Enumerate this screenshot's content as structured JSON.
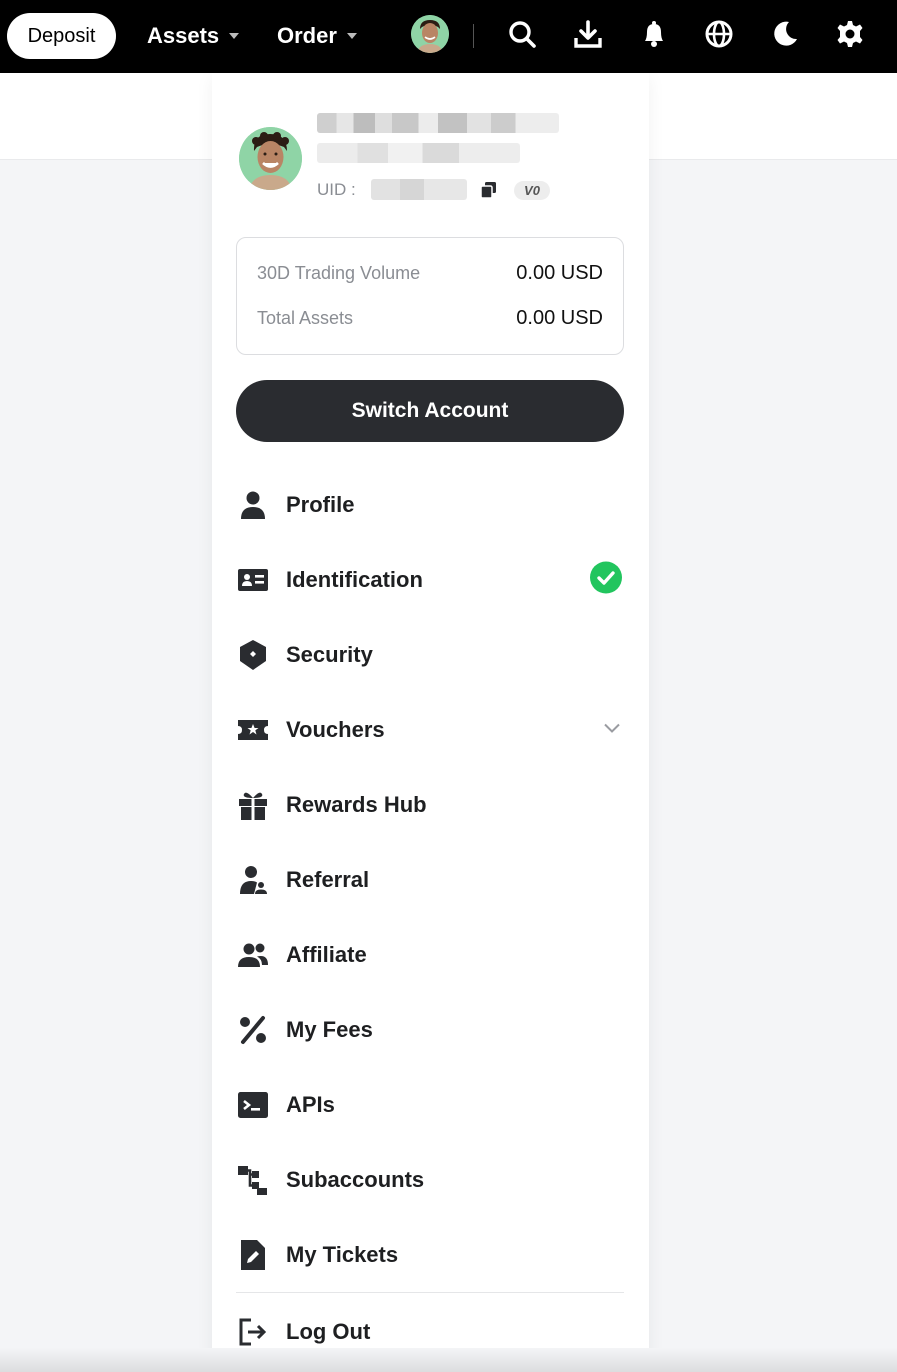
{
  "topbar": {
    "deposit_label": "Deposit",
    "assets_label": "Assets",
    "order_label": "Order",
    "icons": [
      "avatar",
      "search-icon",
      "download-icon",
      "bell-icon",
      "globe-icon",
      "moon-icon",
      "gear-icon"
    ]
  },
  "account": {
    "uid_label": "UID :",
    "vip_level": "V0"
  },
  "stats": {
    "volume_label": "30D Trading Volume",
    "volume_value": "0.00 USD",
    "assets_label": "Total Assets",
    "assets_value": "0.00 USD"
  },
  "switch_account_label": "Switch Account",
  "menu": {
    "items": [
      {
        "label": "Profile",
        "icon": "person-icon"
      },
      {
        "label": "Identification",
        "icon": "id-card-icon",
        "status": "verified"
      },
      {
        "label": "Security",
        "icon": "shield-icon"
      },
      {
        "label": "Vouchers",
        "icon": "ticket-icon",
        "expandable": true
      },
      {
        "label": "Rewards Hub",
        "icon": "gift-icon"
      },
      {
        "label": "Referral",
        "icon": "referral-icon"
      },
      {
        "label": "Affiliate",
        "icon": "group-icon"
      },
      {
        "label": "My Fees",
        "icon": "percent-icon"
      },
      {
        "label": "APIs",
        "icon": "terminal-icon"
      },
      {
        "label": "Subaccounts",
        "icon": "hierarchy-icon"
      },
      {
        "label": "My Tickets",
        "icon": "ticket-doc-icon"
      }
    ],
    "logout_label": "Log Out"
  },
  "colors": {
    "topbar_bg": "#000000",
    "primary_dark": "#2a2c30",
    "verified_green": "#22c55e",
    "avatar_bg": "#8fd4a6"
  }
}
